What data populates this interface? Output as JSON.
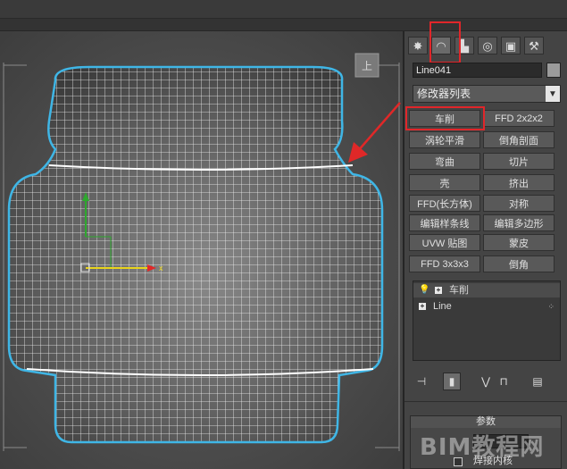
{
  "command_panel": {
    "tabs": [
      {
        "icon": "create-icon",
        "glyph": "✸"
      },
      {
        "icon": "modify-icon",
        "glyph": "◠"
      },
      {
        "icon": "hierarchy-icon",
        "glyph": "▙"
      },
      {
        "icon": "motion-icon",
        "glyph": "◎"
      },
      {
        "icon": "display-icon",
        "glyph": "▣"
      },
      {
        "icon": "utilities-icon",
        "glyph": "⚒"
      }
    ],
    "object_name": "Line041",
    "modifier_list_label": "修改器列表",
    "modifier_buttons": [
      [
        "车削",
        "FFD 2x2x2"
      ],
      [
        "涡轮平滑",
        "倒角剖面"
      ],
      [
        "弯曲",
        "切片"
      ],
      [
        "壳",
        "挤出"
      ],
      [
        "FFD(长方体)",
        "对称"
      ],
      [
        "编辑样条线",
        "编辑多边形"
      ],
      [
        "UVW 贴图",
        "蒙皮"
      ],
      [
        "FFD 3x3x3",
        "倒角"
      ]
    ],
    "stack": [
      {
        "label": "车削"
      },
      {
        "label": "Line"
      }
    ],
    "params_title": "参数",
    "params_checkbox_label": "焊接内核"
  },
  "watermark": "BIM教程网",
  "viewport": {
    "label": ""
  }
}
